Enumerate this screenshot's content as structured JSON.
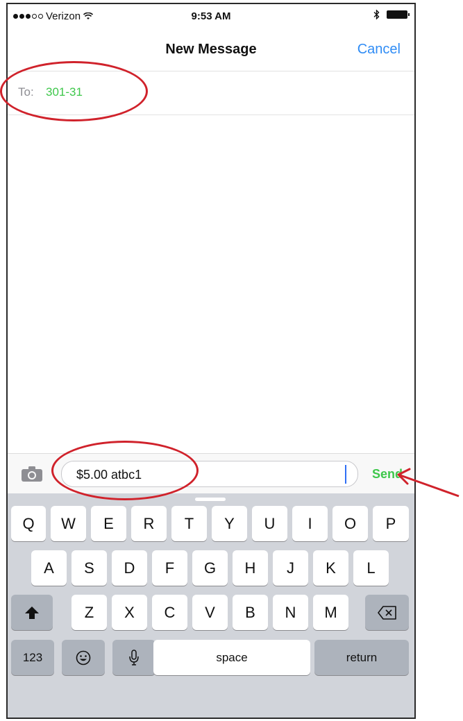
{
  "status_bar": {
    "carrier": "Verizon",
    "time": "9:53 AM"
  },
  "nav": {
    "title": "New Message",
    "cancel_label": "Cancel"
  },
  "recipient": {
    "label": "To:",
    "value": "301-31"
  },
  "compose": {
    "message_text": "$5.00 atbc1",
    "send_label": "Send"
  },
  "keyboard": {
    "row1": [
      "Q",
      "W",
      "E",
      "R",
      "T",
      "Y",
      "U",
      "I",
      "O",
      "P"
    ],
    "row2": [
      "A",
      "S",
      "D",
      "F",
      "G",
      "H",
      "J",
      "K",
      "L"
    ],
    "row3": [
      "Z",
      "X",
      "C",
      "V",
      "B",
      "N",
      "M"
    ],
    "numbers_label": "123",
    "space_label": "space",
    "return_label": "return",
    "icons": {
      "shift": "shift-icon",
      "delete": "backspace-icon",
      "emoji": "emoji-icon",
      "mic": "microphone-icon"
    }
  },
  "colors": {
    "accent_blue": "#2f8cf5",
    "recipient_green": "#3ec74b",
    "annotation_red": "#d0222b"
  }
}
